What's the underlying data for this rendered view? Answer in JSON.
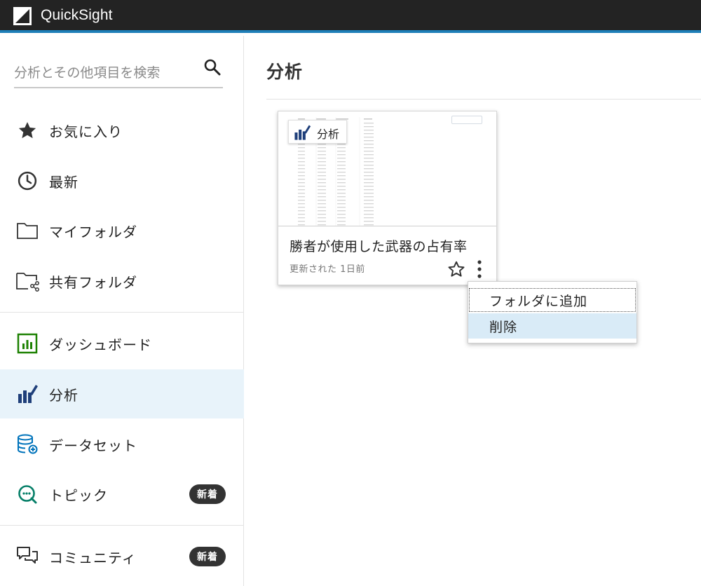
{
  "app": {
    "title": "QuickSight"
  },
  "sidebar": {
    "search_placeholder": "分析とその他項目を検索",
    "items": [
      {
        "label": "お気に入り",
        "icon": "star-icon"
      },
      {
        "label": "最新",
        "icon": "clock-icon"
      },
      {
        "label": "マイフォルダ",
        "icon": "folder-icon"
      },
      {
        "label": "共有フォルダ",
        "icon": "shared-folder-icon"
      },
      {
        "label": "ダッシュボード",
        "icon": "dashboard-icon",
        "icon_color": "#1d8102"
      },
      {
        "label": "分析",
        "icon": "analysis-icon",
        "icon_color": "#1f3f7a",
        "active": true
      },
      {
        "label": "データセット",
        "icon": "dataset-icon",
        "icon_color": "#0073bb"
      },
      {
        "label": "トピック",
        "icon": "topic-icon",
        "icon_color": "#067f68",
        "badge": "新着"
      },
      {
        "label": "コミュニティ",
        "icon": "community-icon",
        "badge": "新着"
      }
    ]
  },
  "main": {
    "title": "分析",
    "card": {
      "thumbnail_label": "分析",
      "title": "勝者が使用した武器の占有率",
      "meta": "更新された 1日前"
    },
    "menu": {
      "items": [
        "フォルダに追加",
        "削除"
      ]
    }
  },
  "colors": {
    "topbar": "#232323",
    "accent": "#1f7fb8",
    "active_bg": "#e8f3fa",
    "menu_hover": "#d9ebf7"
  }
}
